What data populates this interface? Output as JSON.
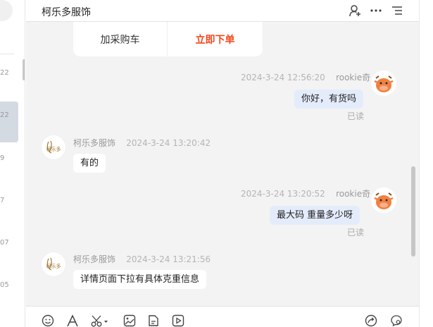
{
  "left_list": {
    "numbers": [
      "22",
      "22",
      "9",
      "7",
      "07",
      "05"
    ]
  },
  "header": {
    "title": "柯乐多服饰",
    "icons": [
      "add-contact-icon",
      "more-icon",
      "list-icon"
    ]
  },
  "product_card": {
    "add_to_cart_label": "加采购车",
    "buy_now_label": "立即下单"
  },
  "messages": [
    {
      "side": "me",
      "sender": "rookie奇",
      "time": "2024-3-24 12:56:20",
      "text": "你好，有货吗",
      "status": "已读"
    },
    {
      "side": "other",
      "sender": "柯乐多服饰",
      "time": "2024-3-24 13:20:42",
      "text": "有的"
    },
    {
      "side": "me",
      "sender": "rookie奇",
      "time": "2024-3-24 13:20:52",
      "text": "最大码  重量多少呀",
      "status": "已读"
    },
    {
      "side": "other",
      "sender": "柯乐多服饰",
      "time": "2024-3-24 13:21:56",
      "text": "详情页面下拉有具体克重信息"
    }
  ],
  "shop_logo_text": "柯乐多",
  "toolbar": {
    "icons": [
      "emoji-icon",
      "font-icon",
      "screenshot-icon",
      "image-icon",
      "file-icon",
      "video-icon",
      "share-icon",
      "chat-settings-icon"
    ]
  },
  "colors": {
    "accent_buy": "#f5461c",
    "my_bubble": "#e4ecfb",
    "chat_bg": "#f3f3f3"
  }
}
